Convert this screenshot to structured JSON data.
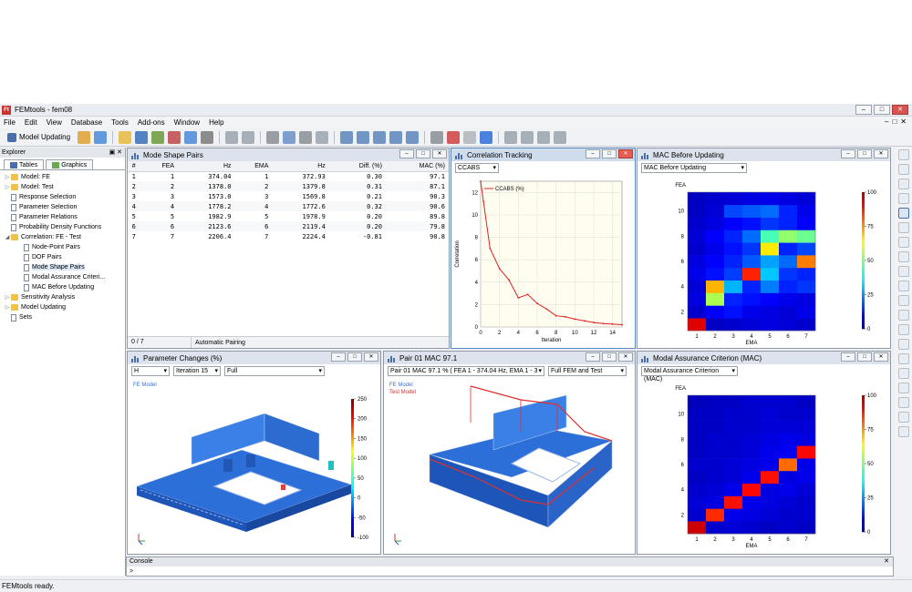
{
  "app": {
    "title": "FEMtools - fem08",
    "icon_text": "Ft",
    "window_buttons": [
      "–",
      "□",
      "✕"
    ],
    "mdi_buttons": [
      "–",
      "□",
      "✕"
    ]
  },
  "menu": [
    "File",
    "Edit",
    "View",
    "Database",
    "Tools",
    "Add-ons",
    "Window",
    "Help"
  ],
  "toolbar": {
    "mode_label": "Model Updating",
    "icons": [
      "run-icon",
      "new-icon",
      "open-icon",
      "save-icon",
      "settings-icon",
      "export-icon",
      "import-icon",
      "print-icon",
      "undo-icon",
      "redo-icon",
      "cut-icon",
      "copy-icon",
      "paste-icon",
      "refresh-icon",
      "window-icon",
      "layout-icon",
      "split-h-icon",
      "split-v-icon",
      "tile-icon",
      "timer-icon",
      "check-icon",
      "stop-icon",
      "help-icon",
      "table-icon",
      "grid-icon",
      "list-icon",
      "globe-icon"
    ]
  },
  "explorer": {
    "title": "Explorer",
    "controls": "▣ ✕",
    "tabs": [
      "Tables",
      "Graphics"
    ],
    "items": [
      {
        "label": "Model: FE",
        "level": 0,
        "icon": "folder",
        "expander": "▷"
      },
      {
        "label": "Model: Test",
        "level": 0,
        "icon": "folder",
        "expander": "▷"
      },
      {
        "label": "Response Selection",
        "level": 0,
        "icon": "doc",
        "expander": ""
      },
      {
        "label": "Parameter Selection",
        "level": 0,
        "icon": "doc",
        "expander": ""
      },
      {
        "label": "Parameter Relations",
        "level": 0,
        "icon": "doc",
        "expander": ""
      },
      {
        "label": "Probability Density Functions",
        "level": 0,
        "icon": "doc",
        "expander": ""
      },
      {
        "label": "Correlation: FE - Test",
        "level": 0,
        "icon": "folder",
        "expander": "◢"
      },
      {
        "label": "Node-Point Pairs",
        "level": 1,
        "icon": "doc",
        "expander": ""
      },
      {
        "label": "DOF Pairs",
        "level": 1,
        "icon": "doc",
        "expander": ""
      },
      {
        "label": "Mode Shape Pairs",
        "level": 1,
        "icon": "doc",
        "expander": "",
        "selected": true
      },
      {
        "label": "Modal Assurance Criteri...",
        "level": 1,
        "icon": "doc",
        "expander": ""
      },
      {
        "label": "MAC Before Updating",
        "level": 1,
        "icon": "doc",
        "expander": ""
      },
      {
        "label": "Sensitivity Analysis",
        "level": 0,
        "icon": "folder",
        "expander": "▷"
      },
      {
        "label": "Model Updating",
        "level": 0,
        "icon": "folder",
        "expander": "▷"
      },
      {
        "label": "Sets",
        "level": 0,
        "icon": "doc",
        "expander": ""
      }
    ]
  },
  "panel_buttons": [
    "–",
    "□",
    "✕"
  ],
  "mode_shape_pairs": {
    "title": "Mode Shape Pairs",
    "columns": [
      "#",
      "FEA",
      "Hz",
      "EMA",
      "Hz",
      "Diff. (%)",
      "MAC (%)"
    ],
    "rows": [
      [
        "1",
        "1",
        "374.04",
        "1",
        "372.93",
        "0.30",
        "97.1"
      ],
      [
        "2",
        "2",
        "1378.0",
        "2",
        "1379.8",
        "0.31",
        "87.1"
      ],
      [
        "3",
        "3",
        "1573.0",
        "3",
        "1569.8",
        "0.21",
        "90.3"
      ],
      [
        "4",
        "4",
        "1778.2",
        "4",
        "1772.6",
        "0.32",
        "90.6"
      ],
      [
        "5",
        "5",
        "1982.9",
        "5",
        "1978.9",
        "0.20",
        "89.8"
      ],
      [
        "6",
        "6",
        "2123.6",
        "6",
        "2119.4",
        "0.20",
        "79.8"
      ],
      [
        "7",
        "7",
        "2206.4",
        "7",
        "2224.4",
        "-0.81",
        "90.8"
      ]
    ],
    "status_count": "0 / 7",
    "status_text": "Automatic Pairing"
  },
  "correlation": {
    "title": "Correlation Tracking",
    "selector": "CCABS",
    "chart_data": {
      "type": "line",
      "legend": "CCABS (%)",
      "xlabel": "Iteration",
      "ylabel": "Correlation",
      "xlim": [
        0,
        15
      ],
      "ylim": [
        0,
        13
      ],
      "xticks": [
        0,
        2,
        4,
        6,
        8,
        10,
        12,
        14
      ],
      "yticks": [
        0,
        2,
        4,
        6,
        8,
        10,
        12
      ],
      "x": [
        0,
        0.3,
        1,
        2,
        3,
        4,
        5,
        6,
        7,
        8,
        9,
        10,
        11,
        12,
        13,
        14,
        15
      ],
      "y": [
        13,
        11.2,
        7,
        5.2,
        4.2,
        2.6,
        2.9,
        2.1,
        1.6,
        1.0,
        0.9,
        0.7,
        0.55,
        0.4,
        0.3,
        0.25,
        0.2
      ]
    }
  },
  "mac_before": {
    "title": "MAC Before Updating",
    "selector": "MAC Before Updating",
    "chart_data": {
      "type": "heatmap",
      "xlabel": "EMA",
      "ylabel": "FEA",
      "x": [
        1,
        2,
        3,
        4,
        5,
        6,
        7
      ],
      "y": [
        1,
        2,
        3,
        4,
        5,
        6,
        7,
        8,
        9,
        10,
        11
      ],
      "xticks": [
        1,
        2,
        3,
        4,
        5,
        6,
        7
      ],
      "yticks": [
        2,
        4,
        6,
        8,
        10
      ],
      "colorbar_ticks": [
        0,
        25,
        50,
        75,
        100
      ],
      "zlim": [
        0,
        100
      ],
      "z": [
        [
          95,
          2,
          3,
          4,
          5,
          4,
          3
        ],
        [
          3,
          8,
          10,
          6,
          5,
          4,
          6
        ],
        [
          5,
          55,
          12,
          10,
          8,
          6,
          5
        ],
        [
          4,
          72,
          28,
          12,
          22,
          12,
          14
        ],
        [
          6,
          10,
          15,
          88,
          30,
          14,
          12
        ],
        [
          5,
          8,
          12,
          18,
          26,
          20,
          78
        ],
        [
          3,
          6,
          10,
          14,
          66,
          12,
          16
        ],
        [
          4,
          8,
          12,
          20,
          44,
          52,
          48
        ],
        [
          3,
          5,
          8,
          10,
          14,
          12,
          8
        ],
        [
          2,
          4,
          16,
          18,
          20,
          12,
          6
        ],
        [
          2,
          3,
          4,
          5,
          6,
          5,
          4
        ]
      ]
    }
  },
  "param_changes": {
    "title": "Parameter Changes (%)",
    "selectors": [
      "H",
      "Iteration 15",
      "Full"
    ],
    "model_label": "FE Model",
    "colorbar_ticks": [
      "250",
      "200",
      "150",
      "100",
      "50",
      "0",
      "-50",
      "-100"
    ]
  },
  "pair01": {
    "title": "Pair 01 MAC  97.1",
    "selectors": [
      "Pair 01 MAC  97.1 %  ( FEA 1 - 374.04 Hz,  EMA 1 - 3",
      "Full FEM and Test"
    ],
    "model_label": "FE Model",
    "test_label": "Test Model"
  },
  "mac": {
    "title": "Modal Assurance Criterion (MAC)",
    "selector": "Modal Assurance Criterion (MAC)",
    "chart_data": {
      "type": "heatmap",
      "xlabel": "EMA",
      "ylabel": "FEA",
      "x": [
        1,
        2,
        3,
        4,
        5,
        6,
        7
      ],
      "y": [
        1,
        2,
        3,
        4,
        5,
        6,
        7,
        8,
        9,
        10,
        11
      ],
      "xticks": [
        1,
        2,
        3,
        4,
        5,
        6,
        7
      ],
      "yticks": [
        2,
        4,
        6,
        8,
        10
      ],
      "colorbar_ticks": [
        0,
        25,
        50,
        75,
        100
      ],
      "zlim": [
        0,
        100
      ],
      "z": [
        [
          97,
          3,
          4,
          3,
          2,
          3,
          2
        ],
        [
          3,
          87,
          6,
          5,
          4,
          3,
          3
        ],
        [
          4,
          5,
          90,
          6,
          5,
          4,
          3
        ],
        [
          3,
          4,
          6,
          91,
          5,
          6,
          4
        ],
        [
          2,
          3,
          4,
          6,
          90,
          5,
          6
        ],
        [
          3,
          3,
          4,
          5,
          6,
          80,
          6
        ],
        [
          2,
          3,
          3,
          4,
          6,
          7,
          91
        ],
        [
          2,
          3,
          3,
          4,
          5,
          6,
          5
        ],
        [
          2,
          2,
          3,
          3,
          4,
          4,
          4
        ],
        [
          2,
          2,
          3,
          3,
          4,
          3,
          3
        ],
        [
          1,
          2,
          2,
          3,
          3,
          3,
          2
        ]
      ]
    }
  },
  "console": {
    "title": "Console",
    "prompt": ">",
    "close": "✕"
  },
  "status": "FEMtools ready."
}
